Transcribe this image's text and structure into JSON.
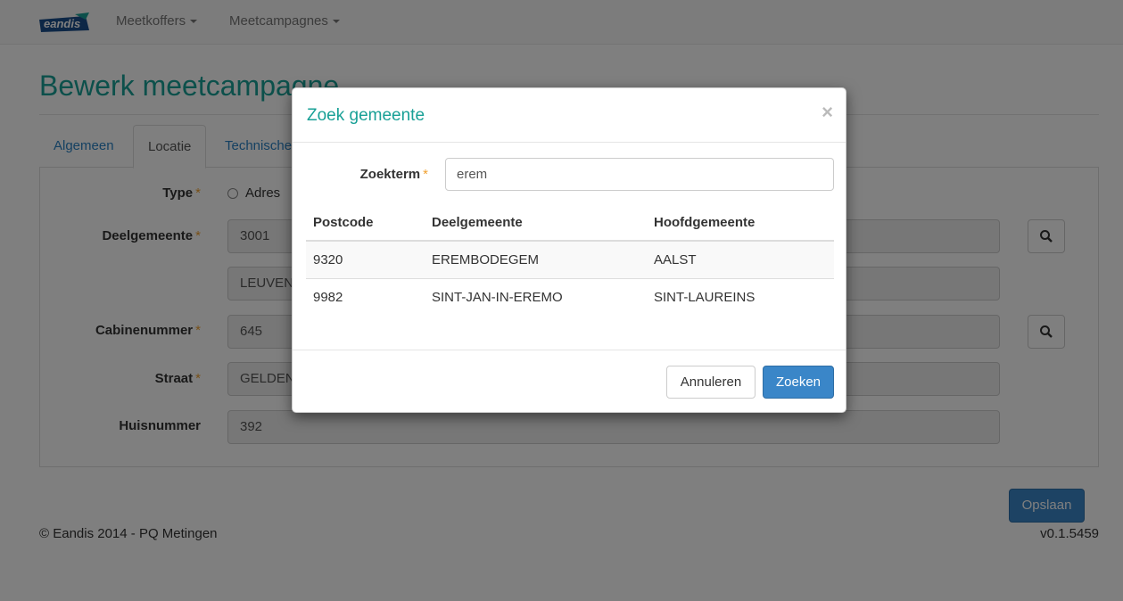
{
  "navbar": {
    "logo_text": "eandis",
    "menus": [
      {
        "label": "Meetkoffers"
      },
      {
        "label": "Meetcampagnes"
      }
    ]
  },
  "page": {
    "title": "Bewerk meetcampagne",
    "tabs": [
      {
        "label": "Algemeen"
      },
      {
        "label": "Locatie"
      },
      {
        "label": "Technische"
      }
    ],
    "form": {
      "type_label": "Type",
      "type_option": "Adres",
      "deelgemeente_label": "Deelgemeente",
      "deelgemeente_postcode": "3001",
      "deelgemeente_name": "LEUVEN",
      "cabinenummer_label": "Cabinenummer",
      "cabinenummer_value": "645",
      "straat_label": "Straat",
      "straat_value": "GELDENA",
      "huisnummer_label": "Huisnummer",
      "huisnummer_value": "392",
      "required_mark": "*"
    },
    "save_label": "Opslaan",
    "footer_left": "© Eandis 2014 - PQ Metingen",
    "footer_right": "v0.1.5459"
  },
  "modal": {
    "title": "Zoek gemeente",
    "close_symbol": "×",
    "search_label": "Zoekterm",
    "search_value": "erem",
    "table": {
      "headers": [
        "Postcode",
        "Deelgemeente",
        "Hoofdgemeente"
      ],
      "rows": [
        [
          "9320",
          "EREMBODEGEM",
          "AALST"
        ],
        [
          "9982",
          "SINT-JAN-IN-EREMO",
          "SINT-LAUREINS"
        ]
      ]
    },
    "cancel_label": "Annuleren",
    "search_button_label": "Zoeken"
  }
}
